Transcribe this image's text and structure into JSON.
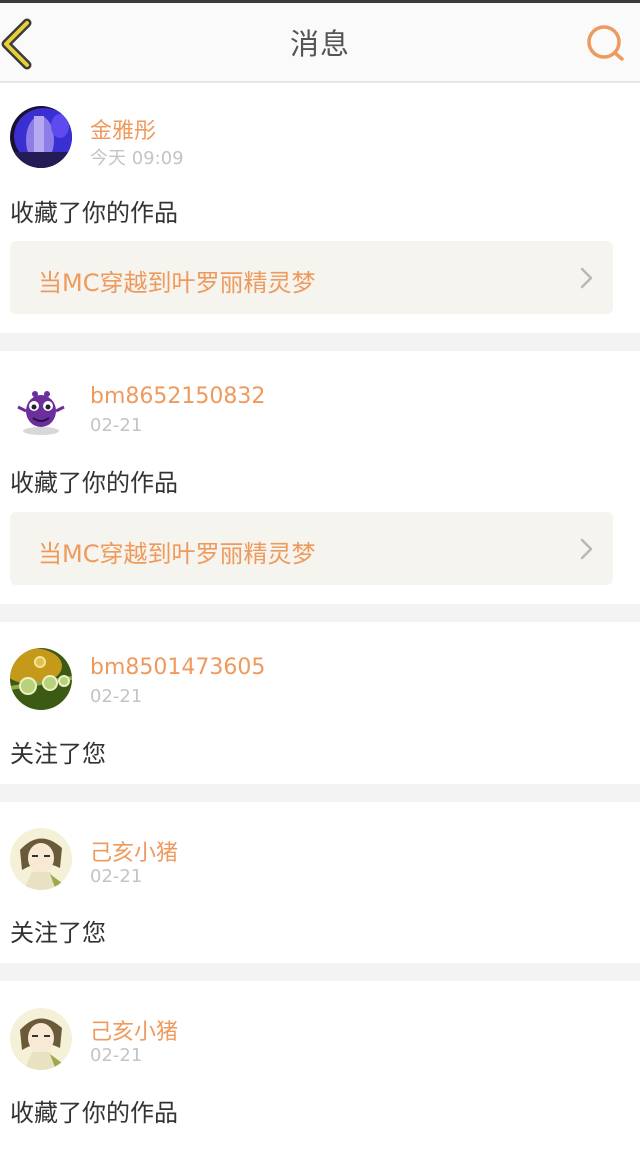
{
  "header": {
    "title": "消息",
    "back_icon": "chevron-left-icon",
    "search_icon": "search-icon",
    "accent_color": "#ef9a5c"
  },
  "messages": [
    {
      "user": "金雅彤",
      "time": "今天 09:09",
      "action": "收藏了你的作品",
      "work": "当MC穿越到叶罗丽精灵梦"
    },
    {
      "user": "bm8652150832",
      "time": "02-21",
      "action": "收藏了你的作品",
      "work": "当MC穿越到叶罗丽精灵梦"
    },
    {
      "user": "bm8501473605",
      "time": "02-21",
      "action": "关注了您"
    },
    {
      "user": "己亥小猪",
      "time": "02-21",
      "action": "关注了您"
    },
    {
      "user": "己亥小猪",
      "time": "02-21",
      "action": "收藏了你的作品"
    }
  ]
}
